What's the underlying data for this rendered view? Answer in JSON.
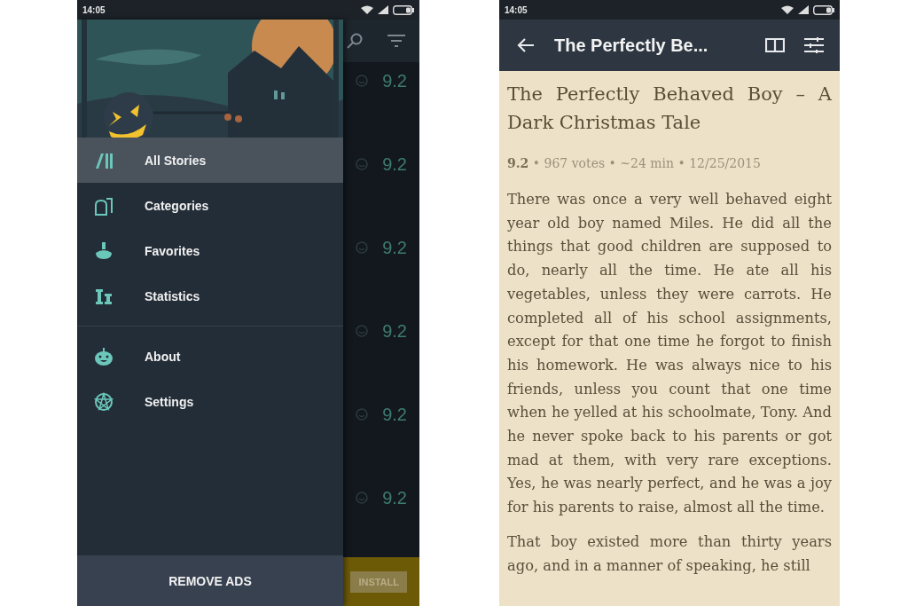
{
  "left_phone": {
    "status_bar": {
      "time": "14:05"
    },
    "background_list": {
      "ratings": [
        "9.2",
        "9.2",
        "9.2",
        "9.2",
        "9.2",
        "9.2"
      ]
    },
    "ad_banner": {
      "button": "INSTALL"
    },
    "drawer": {
      "sections": [
        [
          {
            "label": "All Stories",
            "selected": true
          },
          {
            "label": "Categories",
            "selected": false
          },
          {
            "label": "Favorites",
            "selected": false
          },
          {
            "label": "Statistics",
            "selected": false
          }
        ],
        [
          {
            "label": "About",
            "selected": false
          },
          {
            "label": "Settings",
            "selected": false
          }
        ]
      ],
      "footer_button": "REMOVE ADS"
    }
  },
  "right_phone": {
    "status_bar": {
      "time": "14:05"
    },
    "app_bar": {
      "title": "The Perfectly Be..."
    },
    "story": {
      "title": "The Perfectly Behaved Boy – A Dark Christmas Tale",
      "meta": "**9.2** • 967 votes • ~24 min • 12/25/2015",
      "paragraphs": [
        "There was once a very well behaved eight year old boy named Miles. He did all the things that good children are supposed to do, nearly all the time. He ate all his vegetables, unless they were carrots. He completed all of his school assignments, except for that one time he forgot to finish his homework. He was always nice to his friends, unless you count that one time when he yelled at his schoolmate, Tony. And he never spoke back to his parents or got mad at them, with very rare exceptions. Yes, he was nearly perfect, and he was a joy for his parents to raise, almost all the time.",
        "That boy existed more than thirty years ago, and in a manner of speaking, he still"
      ]
    }
  }
}
